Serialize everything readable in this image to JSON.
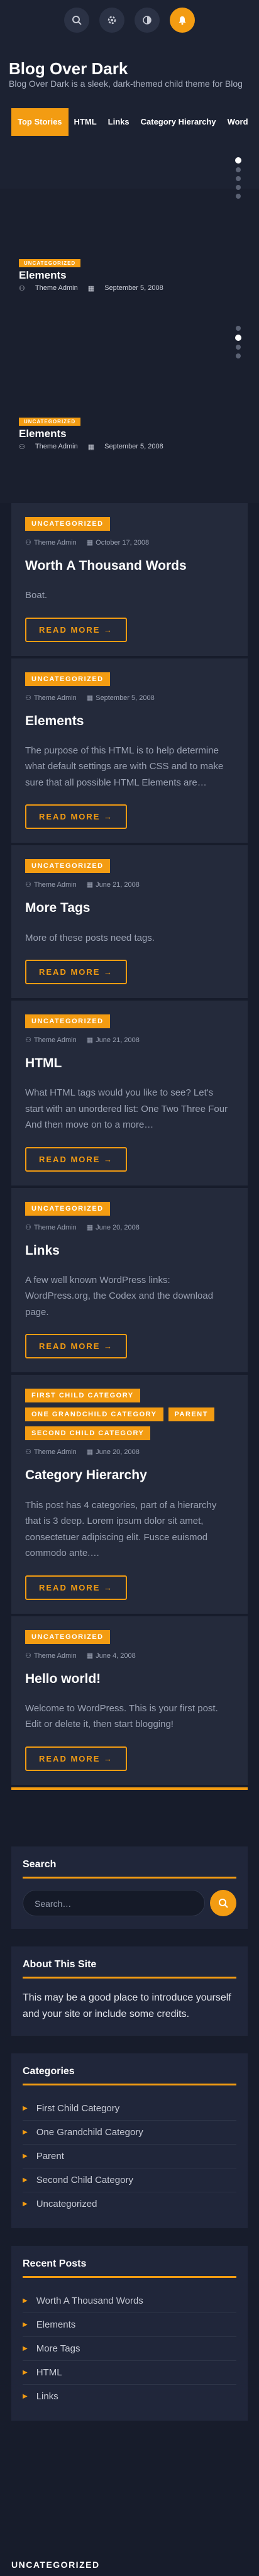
{
  "header": {
    "icons": [
      "search-icon",
      "gear-icon",
      "contrast-icon",
      "bell-icon"
    ],
    "site_title": "Blog Over Dark",
    "tagline": "Blog Over Dark is a sleek, dark-themed child theme for Blog",
    "nav": [
      "Top Stories",
      "HTML",
      "Links",
      "Category Hierarchy",
      "Word"
    ]
  },
  "slider": {
    "slides": [
      {
        "badge": "UNCATEGORIZED",
        "title": "Elements",
        "author": "Theme Admin",
        "date": "September 5, 2008"
      },
      {
        "badge": "UNCATEGORIZED",
        "title": "Elements",
        "author": "Theme Admin",
        "date": "September 5, 2008"
      }
    ]
  },
  "posts": [
    {
      "badges": [
        "UNCATEGORIZED"
      ],
      "author": "Theme Admin",
      "date": "October 17, 2008",
      "title": "Worth A Thousand Words",
      "excerpt": "Boat.",
      "read_more": "READ MORE →"
    },
    {
      "badges": [
        "UNCATEGORIZED"
      ],
      "author": "Theme Admin",
      "date": "September 5, 2008",
      "title": "Elements",
      "excerpt": "The purpose of this HTML is to help determine what default settings are with CSS and to make sure that all possible HTML Elements are…",
      "read_more": "READ MORE →"
    },
    {
      "badges": [
        "UNCATEGORIZED"
      ],
      "author": "Theme Admin",
      "date": "June 21, 2008",
      "title": "More Tags",
      "excerpt": "More of these posts need tags.",
      "read_more": "READ MORE →"
    },
    {
      "badges": [
        "UNCATEGORIZED"
      ],
      "author": "Theme Admin",
      "date": "June 21, 2008",
      "title": "HTML",
      "excerpt": "What HTML tags would you like to see? Let's start with an unordered list: One Two Three Four And then move on to a more…",
      "read_more": "READ MORE →"
    },
    {
      "badges": [
        "UNCATEGORIZED"
      ],
      "author": "Theme Admin",
      "date": "June 20, 2008",
      "title": "Links",
      "excerpt": "A few well known WordPress links: WordPress.org, the Codex and the download page.",
      "read_more": "READ MORE →"
    },
    {
      "badges": [
        "FIRST CHILD CATEGORY",
        "ONE GRANDCHILD CATEGORY",
        "PARENT",
        "SECOND CHILD CATEGORY"
      ],
      "author": "Theme Admin",
      "date": "June 20, 2008",
      "title": "Category Hierarchy",
      "excerpt": "This post has 4 categories, part of a hierarchy that is 3 deep. Lorem ipsum dolor sit amet, consectetuer adipiscing elit. Fusce euismod commodo ante.…",
      "read_more": "READ MORE →"
    },
    {
      "badges": [
        "UNCATEGORIZED"
      ],
      "author": "Theme Admin",
      "date": "June 4, 2008",
      "title": "Hello world!",
      "excerpt": "Welcome to WordPress. This is your first post. Edit or delete it, then start blogging!",
      "read_more": "READ MORE →"
    }
  ],
  "widgets": {
    "search": {
      "title": "Search",
      "placeholder": "Search…"
    },
    "about": {
      "title": "About This Site",
      "text": "This may be a good place to introduce yourself and your site or include some credits."
    },
    "categories": {
      "title": "Categories",
      "items": [
        "First Child Category",
        "One Grandchild Category",
        "Parent",
        "Second Child Category",
        "Uncategorized"
      ]
    },
    "recent": {
      "title": "Recent Posts",
      "items": [
        "Worth A Thousand Words",
        "Elements",
        "More Tags",
        "HTML",
        "Links"
      ]
    }
  },
  "footer": {
    "title": "UNCATEGORIZED"
  },
  "colors": {
    "accent": "#f39c12",
    "background": "#171c2b",
    "card": "#242a3b"
  }
}
